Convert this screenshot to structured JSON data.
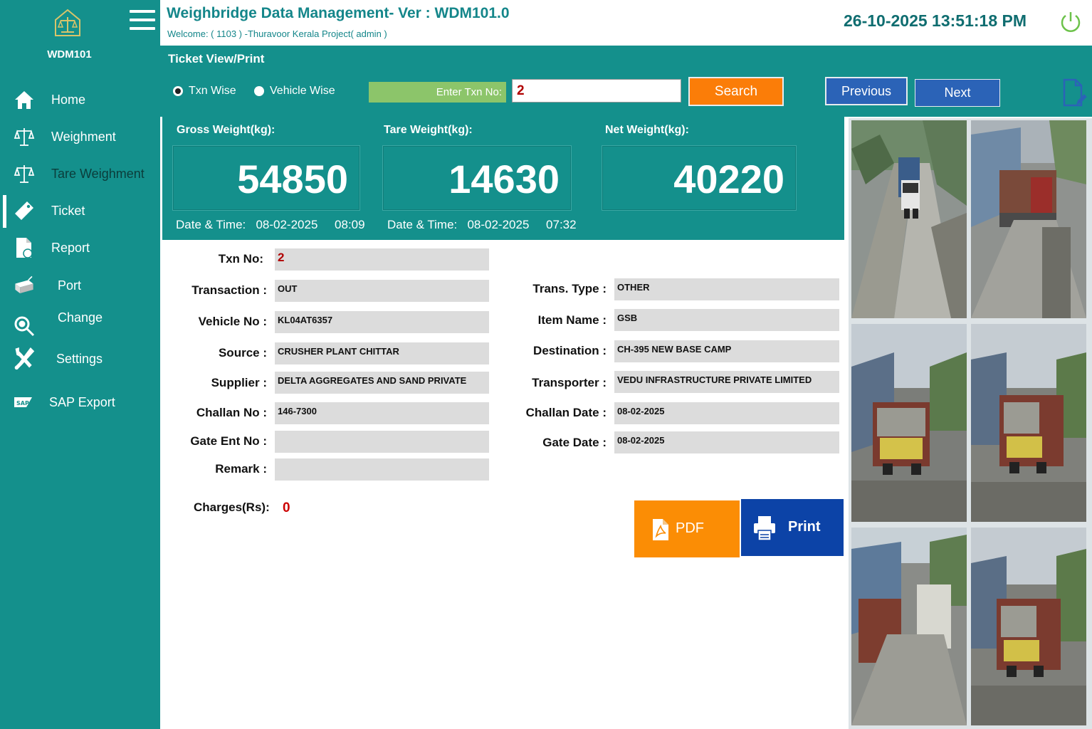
{
  "sidebar": {
    "logo_text": "WDM101",
    "items": [
      {
        "label": "Home",
        "icon": "home-icon"
      },
      {
        "label": "Weighment",
        "icon": "scale-icon"
      },
      {
        "label": "Tare Weighment",
        "icon": "scale-icon"
      },
      {
        "label": "Ticket",
        "icon": "ticket-icon",
        "active": true
      },
      {
        "label": "Report",
        "icon": "report-icon"
      },
      {
        "label": "Port",
        "icon": "port-icon"
      },
      {
        "label": "Change",
        "icon": "search-icon"
      },
      {
        "label": "Settings",
        "icon": "tools-icon"
      },
      {
        "label": "SAP Export",
        "icon": "sap-icon"
      }
    ]
  },
  "header": {
    "title": "Weighbridge Data Management- Ver : WDM101.0",
    "welcome": "Welcome:   ( 1103 ) -Thuravoor Kerala Project( admin )",
    "datetime": "26-10-2025 13:51:18 PM"
  },
  "toolbar": {
    "section_title": "Ticket View/Print",
    "radio_txn": "Txn Wise",
    "radio_vehicle": "Vehicle Wise",
    "txn_label": "Enter Txn No:",
    "txn_value": "2",
    "search": "Search",
    "previous": "Previous",
    "next": "Next"
  },
  "weights": {
    "gross_label": "Gross Weight(kg):",
    "gross_value": "54850",
    "tare_label": "Tare Weight(kg):",
    "tare_value": "14630",
    "net_label": "Net Weight(kg):",
    "net_value": "40220",
    "dt_label": "Date & Time:",
    "gross_date": "08-02-2025",
    "gross_time": "08:09",
    "tare_date": "08-02-2025",
    "tare_time": "07:32"
  },
  "form": {
    "txn_no_label": "Txn No:",
    "txn_no": "2",
    "transaction_label": "Transaction :",
    "transaction": "OUT",
    "vehicle_label": "Vehicle No :",
    "vehicle": "KL04AT6357",
    "source_label": "Source :",
    "source": "CRUSHER PLANT CHITTAR",
    "supplier_label": "Supplier :",
    "supplier": "DELTA AGGREGATES AND SAND PRIVATE",
    "challan_no_label": "Challan No :",
    "challan_no": "146-7300",
    "gate_ent_label": "Gate Ent No :",
    "gate_ent": "",
    "remark_label": "Remark :",
    "remark": "",
    "trans_type_label": "Trans. Type :",
    "trans_type": "OTHER",
    "item_name_label": "Item Name :",
    "item_name": "GSB",
    "destination_label": "Destination :",
    "destination": "CH-395 NEW BASE CAMP",
    "transporter_label": "Transporter :",
    "transporter": "VEDU INFRASTRUCTURE PRIVATE LIMITED",
    "challan_date_label": "Challan Date :",
    "challan_date": "08-02-2025",
    "gate_date_label": "Gate Date :",
    "gate_date": "08-02-2025",
    "charges_label": "Charges(Rs):",
    "charges": "0"
  },
  "actions": {
    "pdf": "PDF",
    "print": "Print"
  },
  "colors": {
    "teal": "#14908c",
    "orange": "#fb7d08",
    "blue": "#2b63b7",
    "navy": "#0c43a7",
    "value_red": "#b00000"
  }
}
